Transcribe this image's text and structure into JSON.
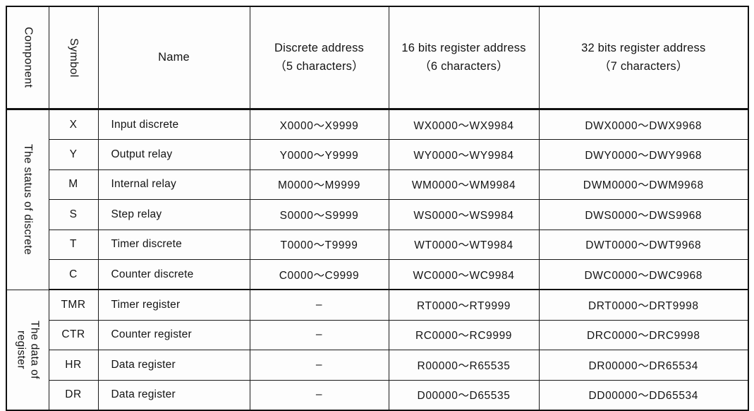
{
  "table": {
    "headers": {
      "component": "Component",
      "symbol": "Symbol",
      "name": "Name",
      "discrete_line1": "Discrete address",
      "discrete_line2": "（5 characters）",
      "reg16_line1": "16 bits register address",
      "reg16_line2": "（6 characters）",
      "reg32_line1": "32 bits register address",
      "reg32_line2": "（7 characters）"
    },
    "groups": [
      {
        "label": "The status of discrete",
        "label_vertical_lines": "The status of discrete",
        "rows": [
          {
            "symbol": "X",
            "name": "Input discrete",
            "discrete": "X0000～X9999",
            "reg16": "WX0000～WX9984",
            "reg32": "DWX0000～DWX9968"
          },
          {
            "symbol": "Y",
            "name": "Output relay",
            "discrete": "Y0000～Y9999",
            "reg16": "WY0000～WY9984",
            "reg32": "DWY0000～DWY9968"
          },
          {
            "symbol": "M",
            "name": "Internal relay",
            "discrete": "M0000～M9999",
            "reg16": "WM0000～WM9984",
            "reg32": "DWM0000～DWM9968"
          },
          {
            "symbol": "S",
            "name": "Step relay",
            "discrete": "S0000～S9999",
            "reg16": "WS0000～WS9984",
            "reg32": "DWS0000～DWS9968"
          },
          {
            "symbol": "T",
            "name": "Timer discrete",
            "discrete": "T0000～T9999",
            "reg16": "WT0000～WT9984",
            "reg32": "DWT0000～DWT9968"
          },
          {
            "symbol": "C",
            "name": "Counter discrete",
            "discrete": "C0000～C9999",
            "reg16": "WC0000～WC9984",
            "reg32": "DWC0000～DWC9968"
          }
        ]
      },
      {
        "label": "The data of register",
        "label_vertical_lines": "The data of\nregister",
        "rows": [
          {
            "symbol": "TMR",
            "name": "Timer register",
            "discrete": "–",
            "reg16": "RT0000～RT9999",
            "reg32": "DRT0000～DRT9998"
          },
          {
            "symbol": "CTR",
            "name": "Counter register",
            "discrete": "–",
            "reg16": "RC0000～RC9999",
            "reg32": "DRC0000～DRC9998"
          },
          {
            "symbol": "HR",
            "name": "Data register",
            "discrete": "–",
            "reg16": "R00000～R65535",
            "reg32": "DR00000～DR65534"
          },
          {
            "symbol": "DR",
            "name": "Data register",
            "discrete": "–",
            "reg16": "D00000～D65535",
            "reg32": "DD00000～DD65534"
          }
        ]
      }
    ]
  },
  "colors": {
    "border": "#111111",
    "text": "#141414",
    "background": "#fdfdfd"
  }
}
